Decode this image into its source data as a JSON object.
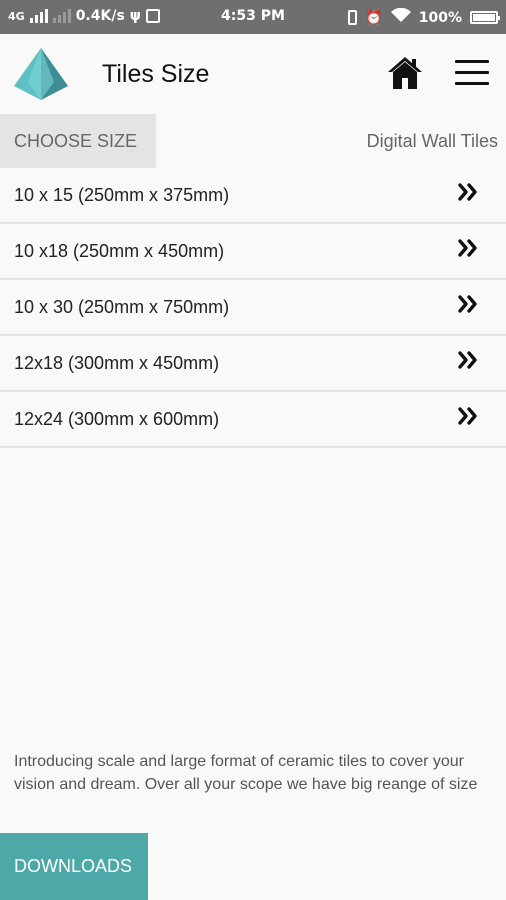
{
  "status_bar": {
    "network": "4G",
    "speed": "0.4K/s",
    "time": "4:53 PM",
    "battery": "100%"
  },
  "app_bar": {
    "title": "Tiles Size"
  },
  "subheader": {
    "choose_size_label": "CHOOSE SIZE",
    "category_label": "Digital Wall Tiles"
  },
  "sizes": [
    {
      "label": "10 x 15 (250mm x 375mm)"
    },
    {
      "label": "10 x18 (250mm x 450mm)"
    },
    {
      "label": "10 x 30 (250mm x 750mm)"
    },
    {
      "label": "12x18 (300mm x 450mm)"
    },
    {
      "label": "12x24 (300mm x 600mm)"
    }
  ],
  "intro_text": "Introducing scale and large format of ceramic tiles to cover your vision and dream. Over all your scope we have big reange of size",
  "downloads_label": "DOWNLOADS",
  "colors": {
    "accent": "#4fa8a8",
    "status_bar": "#6f6f6f",
    "background": "#f9f9f9"
  },
  "icons": {
    "logo": "triangle-logo-icon",
    "home": "home-icon",
    "menu": "hamburger-menu-icon",
    "row_chevron": "double-chevron-right-icon"
  }
}
